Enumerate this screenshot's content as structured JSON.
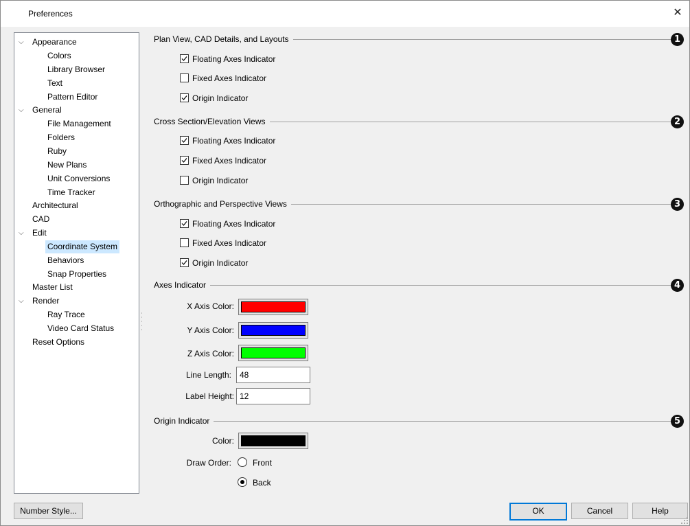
{
  "window": {
    "title": "Preferences",
    "close_glyph": "✕"
  },
  "tree": {
    "items": [
      {
        "label": "Appearance",
        "expanded": true
      },
      {
        "label": "Colors"
      },
      {
        "label": "Library Browser"
      },
      {
        "label": "Text"
      },
      {
        "label": "Pattern Editor"
      },
      {
        "label": "General",
        "expanded": true
      },
      {
        "label": "File Management"
      },
      {
        "label": "Folders"
      },
      {
        "label": "Ruby"
      },
      {
        "label": "New Plans"
      },
      {
        "label": "Unit Conversions"
      },
      {
        "label": "Time Tracker"
      },
      {
        "label": "Architectural"
      },
      {
        "label": "CAD"
      },
      {
        "label": "Edit",
        "expanded": true
      },
      {
        "label": "Coordinate System",
        "selected": true
      },
      {
        "label": "Behaviors"
      },
      {
        "label": "Snap Properties"
      },
      {
        "label": "Master List"
      },
      {
        "label": "Render",
        "expanded": true
      },
      {
        "label": "Ray Trace"
      },
      {
        "label": "Video Card Status"
      },
      {
        "label": "Reset Options"
      }
    ]
  },
  "sections": [
    {
      "title": "Plan View, CAD Details, and Layouts",
      "badge": "1",
      "options": [
        {
          "label": "Floating Axes Indicator",
          "checked": true
        },
        {
          "label": "Fixed Axes Indicator",
          "checked": false
        },
        {
          "label": "Origin Indicator",
          "checked": true
        }
      ]
    },
    {
      "title": "Cross Section/Elevation Views",
      "badge": "2",
      "options": [
        {
          "label": "Floating Axes Indicator",
          "checked": true
        },
        {
          "label": "Fixed Axes Indicator",
          "checked": true
        },
        {
          "label": "Origin Indicator",
          "checked": false
        }
      ]
    },
    {
      "title": "Orthographic and Perspective Views",
      "badge": "3",
      "options": [
        {
          "label": "Floating Axes Indicator",
          "checked": true
        },
        {
          "label": "Fixed Axes Indicator",
          "checked": false
        },
        {
          "label": "Origin Indicator",
          "checked": true
        }
      ]
    }
  ],
  "axes_indicator": {
    "title": "Axes Indicator",
    "badge": "4",
    "x_label": "X Axis Color:",
    "x_color": "#ff0000",
    "y_label": "Y Axis Color:",
    "y_color": "#0000ff",
    "z_label": "Z Axis Color:",
    "z_color": "#00ff00",
    "line_length_label": "Line Length:",
    "line_length_value": "48",
    "label_height_label": "Label Height:",
    "label_height_value": "12"
  },
  "origin_indicator": {
    "title": "Origin Indicator",
    "badge": "5",
    "color_label": "Color:",
    "color": "#000000",
    "draw_order_label": "Draw Order:",
    "front_label": "Front",
    "back_label": "Back",
    "selected": "Back"
  },
  "buttons": {
    "number_style": "Number Style...",
    "ok": "OK",
    "cancel": "Cancel",
    "help": "Help"
  }
}
